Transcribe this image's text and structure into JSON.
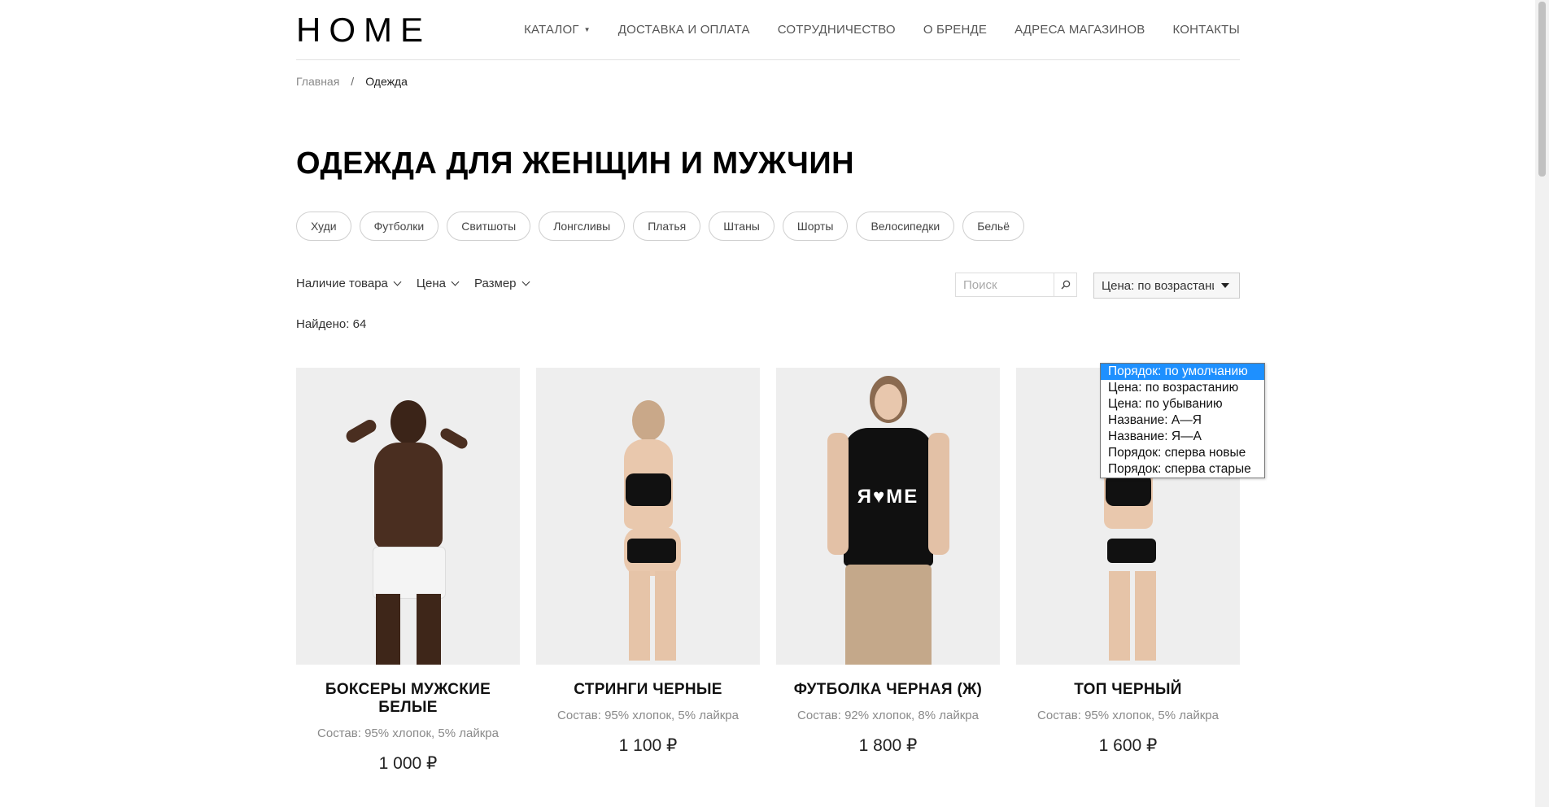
{
  "header": {
    "logo": "HOME",
    "nav": [
      "КАТАЛОГ",
      "ДОСТАВКА И ОПЛАТА",
      "СОТРУДНИЧЕСТВО",
      "О БРЕНДЕ",
      "АДРЕСА МАГАЗИНОВ",
      "КОНТАКТЫ"
    ]
  },
  "breadcrumb": {
    "home": "Главная",
    "separator": "/",
    "current": "Одежда"
  },
  "page_title": "ОДЕЖДА ДЛЯ ЖЕНЩИН И МУЖЧИН",
  "categories": [
    "Худи",
    "Футболки",
    "Свитшоты",
    "Лонгсливы",
    "Платья",
    "Штаны",
    "Шорты",
    "Велосипедки",
    "Бельё"
  ],
  "filters": [
    "Наличие товара",
    "Цена",
    "Размер"
  ],
  "search": {
    "placeholder": "Поиск",
    "icon": "search-icon"
  },
  "sort": {
    "selected": "Цена: по возрастанию",
    "options": [
      "Порядок: по умолчанию",
      "Цена: по возрастанию",
      "Цена: по убыванию",
      "Название: А—Я",
      "Название: Я—А",
      "Порядок: сперва новые",
      "Порядок: сперва старые"
    ],
    "highlighted": "Порядок: по умолчанию"
  },
  "found": "Найдено: 64",
  "products": [
    {
      "title": "БОКСЕРЫ МУЖСКИЕ БЕЛЫЕ",
      "desc": "Состав: 95% хлопок, 5% лайкра",
      "price": "1 000 ₽"
    },
    {
      "title": "СТРИНГИ ЧЕРНЫЕ",
      "desc": "Состав: 95% хлопок, 5% лайкра",
      "price": "1 100 ₽"
    },
    {
      "title": "ФУТБОЛКА ЧЕРНАЯ (Ж)",
      "desc": "Состав: 92% хлопок, 8% лайкра",
      "price": "1 800 ₽"
    },
    {
      "title": "ТОП ЧЕРНЫЙ",
      "desc": "Состав: 95% хлопок, 5% лайкра",
      "price": "1 600 ₽"
    }
  ],
  "tshirt_print": "Я♥МЕ",
  "colors": {
    "accent": "#1e90ff",
    "text": "#000000",
    "muted": "#8a8a8a",
    "border": "#cfcfcf"
  }
}
